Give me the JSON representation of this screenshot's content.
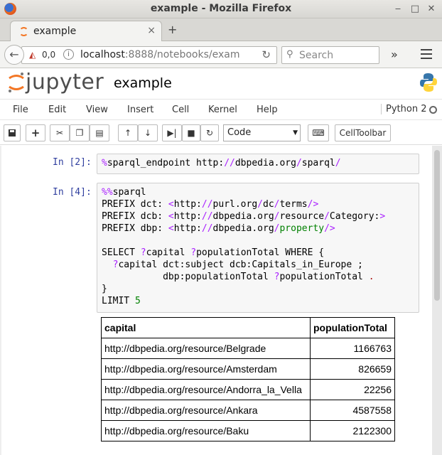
{
  "window": {
    "title": "example - Mozilla Firefox",
    "min": "‒",
    "max": "□",
    "close": "✕"
  },
  "tab": {
    "label": "example",
    "close": "×",
    "new_tab": "+"
  },
  "nav": {
    "back": "←",
    "tracking_count": "0,0",
    "url_host": "localhost",
    "url_rest": ":8888/notebooks/exam",
    "reload": "↻",
    "search_placeholder": "Search",
    "overflow": "»"
  },
  "jupyter": {
    "logo": "jupyter",
    "notebook_name": "example"
  },
  "menu": [
    "File",
    "Edit",
    "View",
    "Insert",
    "Cell",
    "Kernel",
    "Help"
  ],
  "kernel": {
    "name": "Python 2"
  },
  "toolbar": {
    "cell_type": "Code",
    "celltoolbar_label": "CellToolbar",
    "icons": [
      "save-icon",
      "plus-icon",
      "cut-icon",
      "copy-icon",
      "paste-icon",
      "arrow-up-icon",
      "arrow-down-icon",
      "step-forward-icon",
      "stop-icon",
      "restart-icon",
      "keyboard-icon"
    ]
  },
  "cells": [
    {
      "prompt": "In [2]:"
    },
    {
      "prompt": "In [4]:"
    }
  ],
  "table": {
    "headers": [
      "capital",
      "populationTotal"
    ],
    "rows": [
      [
        "http://dbpedia.org/resource/Belgrade",
        "1166763"
      ],
      [
        "http://dbpedia.org/resource/Amsterdam",
        "826659"
      ],
      [
        "http://dbpedia.org/resource/Andorra_la_Vella",
        "22256"
      ],
      [
        "http://dbpedia.org/resource/Ankara",
        "4587558"
      ],
      [
        "http://dbpedia.org/resource/Baku",
        "2122300"
      ]
    ]
  },
  "colors": {
    "prompt": "#303f9f",
    "magic": "#aa22ff",
    "keyword": "#008000",
    "jupyter_orange": "#f37726"
  }
}
